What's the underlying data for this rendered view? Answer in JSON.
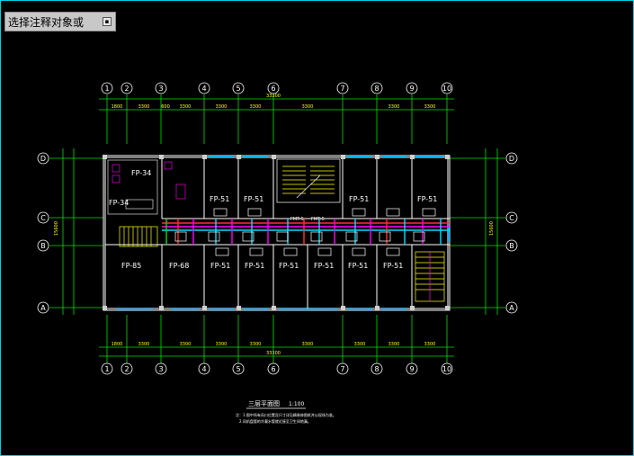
{
  "prompt": {
    "text": "选择注释对象或",
    "button_icon": "dropdown-arrow-icon"
  },
  "axes_top": [
    "1",
    "2",
    "3",
    "4",
    "5",
    "6",
    "7",
    "8",
    "9",
    "10"
  ],
  "axes_side": [
    "D",
    "C",
    "B",
    "A"
  ],
  "dims": {
    "top_total": "33300",
    "top_segments": [
      "1800",
      "3300",
      "600",
      "3300",
      "3300",
      "3300",
      "3300",
      "3300",
      "3300"
    ],
    "bottom_total": "33300",
    "bottom_segments": [
      "1800",
      "3300",
      "3300",
      "3300",
      "3300",
      "3300",
      "3300",
      "3300",
      "3300"
    ],
    "left_total": "15600",
    "right_total": "15600"
  },
  "units": {
    "fp_top": [
      "FP-51",
      "FP-51",
      "FP-51",
      "FP-51"
    ],
    "fp_top_left": "FP-34",
    "fp_left_small": "FP-34",
    "fp_bottom": [
      "FP-85",
      "FP-68",
      "FP-51",
      "FP-51",
      "FP-51",
      "FP-51",
      "FP-51",
      "FP-51"
    ],
    "pipe_labels": [
      "FMT-5",
      "FMT-5"
    ]
  },
  "title": {
    "main": "三层平面图",
    "scale": "1:100",
    "note1": "注：1.图中所有风口位置及尺寸详见精装修图纸并以现场为准。",
    "note2": "2.风机盘管的冷凝水管就近接至卫生间地漏。"
  },
  "colors": {
    "wall": "#ffffff",
    "axis": "#00e000",
    "dim": "#ffff00",
    "pipe_red": "#ff3030",
    "pipe_magenta": "#ff00ff",
    "pipe_cyan": "#00e0ff",
    "window": "#00b0ff"
  }
}
